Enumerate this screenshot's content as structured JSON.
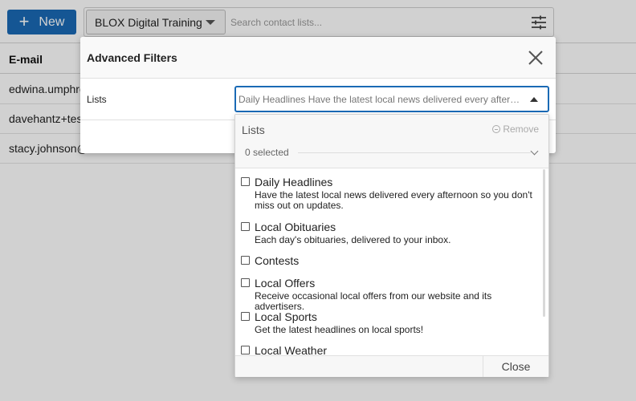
{
  "toolbar": {
    "new_label": "New",
    "site_select_value": "BLOX Digital Training",
    "search_placeholder": "Search contact lists..."
  },
  "table": {
    "column_email": "E-mail",
    "rows": [
      "edwina.umphre",
      "davehantz+tes",
      "stacy.johnson@"
    ]
  },
  "modal": {
    "title": "Advanced Filters",
    "lists_label": "Lists",
    "lists_value": "Daily Headlines Have the latest local news delivered every afternoon so you don't miss out on updates."
  },
  "dropdown": {
    "title": "Lists",
    "remove_label": "Remove",
    "selected_label": "0 selected",
    "items": [
      {
        "name": "Daily Headlines",
        "desc": "Have the latest local news delivered every afternoon so you don't miss out on updates."
      },
      {
        "name": "Local Obituaries",
        "desc": "Each day's obituaries, delivered to your inbox."
      },
      {
        "name": "Contests",
        "desc": ""
      },
      {
        "name": "Local Offers",
        "desc": "Receive occasional local offers from our website and its advertisers."
      },
      {
        "name": "Local Sports",
        "desc": "Get the latest headlines on local sports!"
      },
      {
        "name": "Local Weather",
        "desc": ""
      }
    ],
    "close_label": "Close"
  },
  "colors": {
    "accent": "#1a6ab5"
  }
}
